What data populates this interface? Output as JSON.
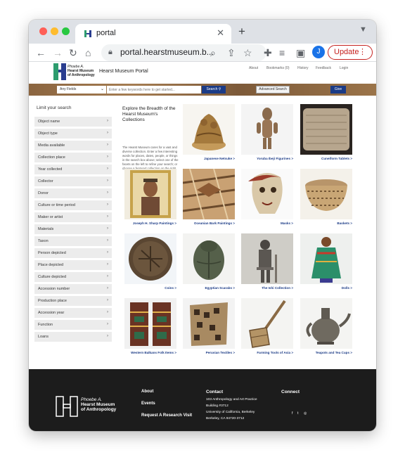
{
  "browser": {
    "tab_title": "portal",
    "tab_close": "✕",
    "new_tab": "+",
    "url": "portal.hearstmuseum.b...",
    "profile_initial": "J",
    "update_label": "Update"
  },
  "site": {
    "logo_lines": [
      "Phoebe A.",
      "Hearst Museum",
      "of Anthropology"
    ],
    "portal_title": "Hearst Museum Portal",
    "nav": [
      "About",
      "Bookmarks (0)",
      "History",
      "Feedback",
      "Login"
    ]
  },
  "search": {
    "field_select": "Any Fields",
    "placeholder": "Enter a few keywords here to get started...",
    "search_label": "Search",
    "advanced_label": "Advanced Search",
    "give_label": "Give"
  },
  "sidebar": {
    "title": "Limit your search",
    "facets": [
      "Object name",
      "Object type",
      "Media available",
      "Collection place",
      "Year collected",
      "Collector",
      "Donor",
      "Culture or time period",
      "Maker or artist",
      "Materials",
      "Taxon",
      "Person depicted",
      "Place depicted",
      "Culture depicted",
      "Accession number",
      "Production place",
      "Accession year",
      "Function",
      "Loans"
    ]
  },
  "intro": {
    "title": "Explore the Breadth of the Hearst Museum's Collections",
    "body": "The Hearst Museum cares for a vast and diverse collection. Enter a few interesting words for places, dates, people, or things in the search box above; select one of the facets on the left to refine your search; or choose a featured collection on the right."
  },
  "collections": [
    {
      "label": "Japanese Netsuke >"
    },
    {
      "label": "Yoruba Ibeji Figurines >"
    },
    {
      "label": "Cuneiform Tablets >"
    },
    {
      "label": "Joseph H. Sharp Paintings >"
    },
    {
      "label": "Oceanian Bark Paintings >"
    },
    {
      "label": "Masks >"
    },
    {
      "label": "Baskets >"
    },
    {
      "label": "Coins >"
    },
    {
      "label": "Egyptian Scarabs >"
    },
    {
      "label": "The Ishi Collection >"
    },
    {
      "label": "Dolls >"
    },
    {
      "label": "Western Balkans Folk Items >"
    },
    {
      "label": "Peruvian Textiles >"
    },
    {
      "label": "Farming Tools of Asia >"
    },
    {
      "label": "Teapots and Tea Cups >"
    }
  ],
  "footer": {
    "logo_lines": [
      "Phoebe A.",
      "Hearst Museum",
      "of Anthropology"
    ],
    "links": [
      "About",
      "Events",
      "Request A Research Visit"
    ],
    "contact_heading": "Contact",
    "address": [
      "103 Anthropology and Art Practice",
      "Building #3712",
      "University of California, Berkeley",
      "Berkeley, CA 94720-3712"
    ],
    "connect_heading": "Connect"
  }
}
